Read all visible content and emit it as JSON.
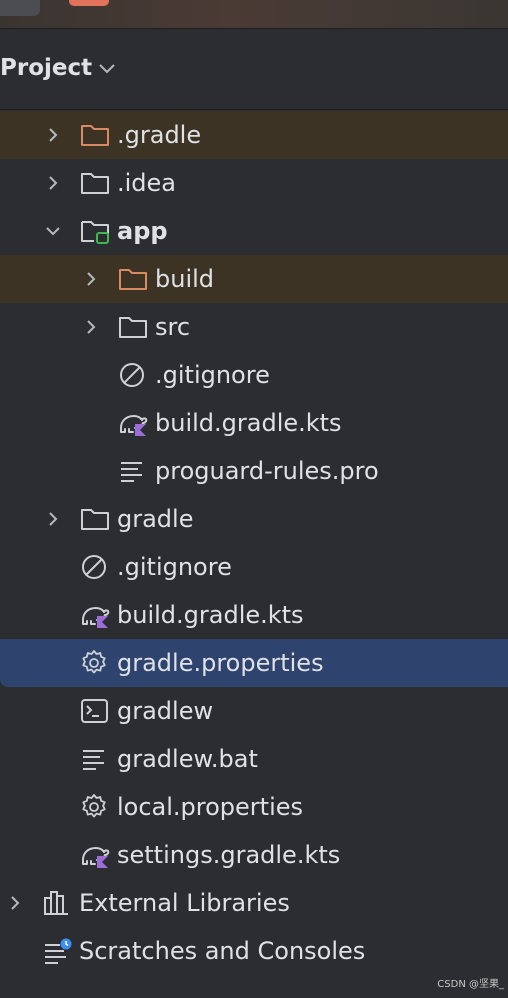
{
  "panel": {
    "title": "Project"
  },
  "tree": {
    "items": [
      {
        "label": ".gradle",
        "icon": "folder-excluded-icon"
      },
      {
        "label": ".idea",
        "icon": "folder-icon"
      },
      {
        "label": "app",
        "icon": "module-folder-icon"
      },
      {
        "label": "build",
        "icon": "folder-excluded-icon"
      },
      {
        "label": "src",
        "icon": "folder-icon"
      },
      {
        "label": ".gitignore",
        "icon": "ignore-file-icon"
      },
      {
        "label": "build.gradle.kts",
        "icon": "gradle-kotlin-icon"
      },
      {
        "label": "proguard-rules.pro",
        "icon": "text-file-icon"
      },
      {
        "label": "gradle",
        "icon": "folder-icon"
      },
      {
        "label": ".gitignore",
        "icon": "ignore-file-icon"
      },
      {
        "label": "build.gradle.kts",
        "icon": "gradle-kotlin-icon"
      },
      {
        "label": "gradle.properties",
        "icon": "properties-gear-icon"
      },
      {
        "label": "gradlew",
        "icon": "terminal-script-icon"
      },
      {
        "label": "gradlew.bat",
        "icon": "text-file-icon"
      },
      {
        "label": "local.properties",
        "icon": "properties-gear-icon"
      },
      {
        "label": "settings.gradle.kts",
        "icon": "gradle-kotlin-icon"
      },
      {
        "label": "External Libraries",
        "icon": "libraries-icon"
      },
      {
        "label": "Scratches and Consoles",
        "icon": "scratches-icon"
      }
    ]
  },
  "colors": {
    "background": "#2b2d30",
    "selected_row": "#2e436e",
    "excluded_row": "#3d3325",
    "excluded_folder": "#d88a62",
    "module_badge": "#3fb950",
    "kotlin_badge": "#9a6dd7",
    "text": "#dfe1e5"
  },
  "watermark": "CSDN @坚果_"
}
